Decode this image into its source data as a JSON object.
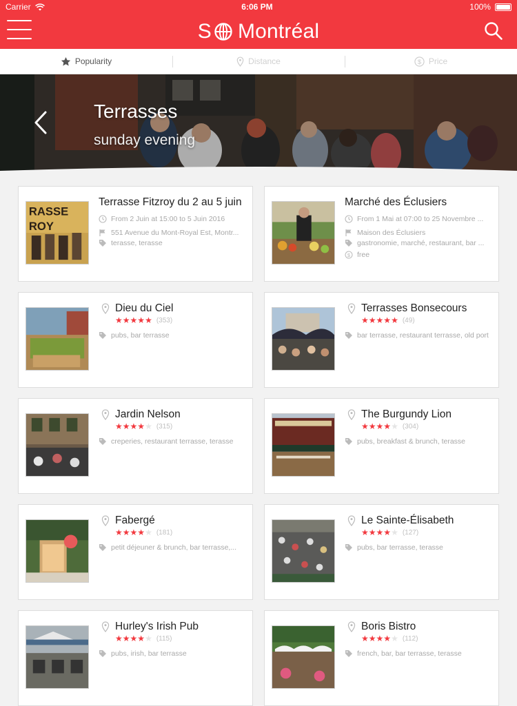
{
  "status_bar": {
    "carrier": "Carrier",
    "time": "6:06 PM",
    "battery": "100%"
  },
  "header": {
    "logo_text": "S",
    "logo_text_rest": "Montréal"
  },
  "filters": [
    {
      "label": "Popularity",
      "icon": "star-icon",
      "active": true
    },
    {
      "label": "Distance",
      "icon": "pin-icon",
      "active": false
    },
    {
      "label": "Price",
      "icon": "dollar-icon",
      "active": false
    }
  ],
  "hero": {
    "title": "Terrasses",
    "subtitle": "sunday evening"
  },
  "events": [
    {
      "title": "Terrasse Fitzroy du 2 au 5 juin",
      "dates": "From 2 Juin at 15:00 to 5 Juin 2016",
      "address": "551 Avenue du Mont-Royal Est, Montr...",
      "tags": "terasse, terasse",
      "price": ""
    },
    {
      "title": "Marché des Éclusiers",
      "dates": "From 1 Mai at 07:00 to 25 Novembre ...",
      "address": "Maison des Éclusiers",
      "tags": "gastronomie, marché, restaurant, bar ...",
      "price": "free"
    }
  ],
  "venues": [
    {
      "name": "Dieu du Ciel",
      "rating": 5,
      "count": "(353)",
      "tags": "pubs, bar terrasse"
    },
    {
      "name": "Terrasses Bonsecours",
      "rating": 5,
      "count": "(49)",
      "tags": "bar terrasse, restaurant terrasse, old port"
    },
    {
      "name": "Jardin Nelson",
      "rating": 4,
      "count": "(315)",
      "tags": "creperies, restaurant terrasse, terasse"
    },
    {
      "name": "The Burgundy Lion",
      "rating": 4,
      "count": "(304)",
      "tags": "pubs, breakfast & brunch, terasse"
    },
    {
      "name": "Fabergé",
      "rating": 4,
      "count": "(181)",
      "tags": "petit déjeuner & brunch, bar terrasse,..."
    },
    {
      "name": "Le Sainte-Élisabeth",
      "rating": 4,
      "count": "(127)",
      "tags": "pubs, bar terrasse, terasse"
    },
    {
      "name": "Hurley's Irish Pub",
      "rating": 4,
      "count": "(115)",
      "tags": "pubs, irish, bar terrasse"
    },
    {
      "name": "Boris Bistro",
      "rating": 4,
      "count": "(112)",
      "tags": "french, bar, bar terrasse, terasse"
    }
  ],
  "colors": {
    "brand": "#f2393f",
    "muted": "#a8a8a8"
  }
}
